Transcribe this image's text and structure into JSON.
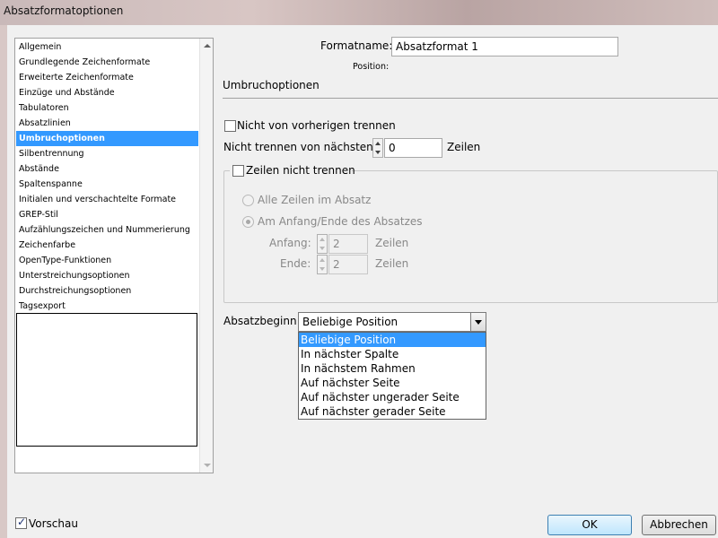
{
  "window": {
    "title": "Absatzformatoptionen"
  },
  "categories": [
    {
      "label": "Allgemein"
    },
    {
      "label": "Grundlegende Zeichenformate"
    },
    {
      "label": "Erweiterte Zeichenformate"
    },
    {
      "label": "Einzüge und Abstände"
    },
    {
      "label": "Tabulatoren"
    },
    {
      "label": "Absatzlinien"
    },
    {
      "label": "Umbruchoptionen",
      "selected": true
    },
    {
      "label": "Silbentrennung"
    },
    {
      "label": "Abstände"
    },
    {
      "label": "Spaltenspanne"
    },
    {
      "label": "Initialen und verschachtelte Formate"
    },
    {
      "label": "GREP-Stil"
    },
    {
      "label": "Aufzählungszeichen und Nummerierung"
    },
    {
      "label": "Zeichenfarbe"
    },
    {
      "label": "OpenType-Funktionen"
    },
    {
      "label": "Unterstreichungsoptionen"
    },
    {
      "label": "Durchstreichungsoptionen"
    },
    {
      "label": "Tagsexport"
    }
  ],
  "format": {
    "name_label": "Formatname:",
    "name_value": "Absatzformat 1",
    "position_label": "Position:"
  },
  "section": {
    "title": "Umbruchoptionen"
  },
  "options": {
    "keep_with_previous": {
      "label": "Nicht von vorherigen trennen",
      "checked": false
    },
    "keep_with_next": {
      "label": "Nicht trennen von nächsten:",
      "value": "0",
      "unit": "Zeilen"
    },
    "keep_lines_together": {
      "label": "Zeilen nicht trennen",
      "checked": false
    },
    "all_lines": {
      "label": "Alle Zeilen im Absatz"
    },
    "at_start_end": {
      "label": "Am Anfang/Ende des Absatzes"
    },
    "start": {
      "label": "Anfang:",
      "value": "2",
      "unit": "Zeilen"
    },
    "end": {
      "label": "Ende:",
      "value": "2",
      "unit": "Zeilen"
    }
  },
  "paragraph_start": {
    "label": "Absatzbeginn:",
    "value": "Beliebige Position",
    "options": [
      "Beliebige Position",
      "In nächster Spalte",
      "In nächstem Rahmen",
      "Auf nächster Seite",
      "Auf nächster ungerader Seite",
      "Auf nächster gerader Seite"
    ]
  },
  "footer": {
    "preview_label": "Vorschau",
    "preview_checked": true,
    "ok_label": "OK",
    "cancel_label": "Abbrechen"
  },
  "colors": {
    "selection": "#3399ff",
    "accent_check": "#1a2f70"
  }
}
